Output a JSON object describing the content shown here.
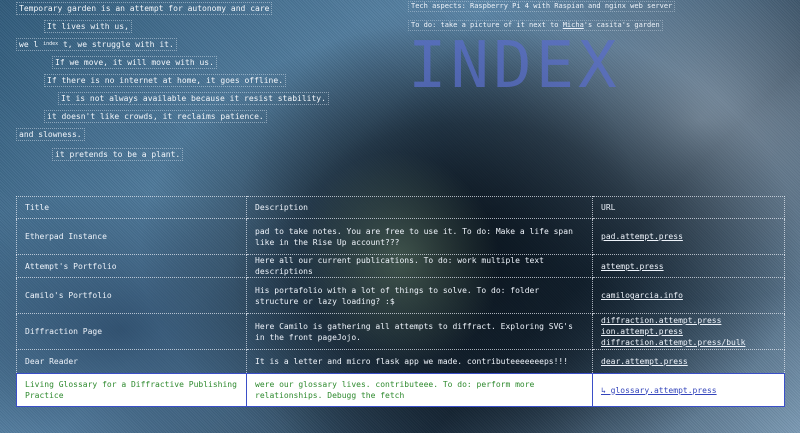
{
  "manifesto": {
    "lines": [
      "Temporary garden is an attempt for autonomy and care",
      "It lives with us,",
      "we l",
      "index",
      "t, we struggle with it.",
      "If we move, it will move with us.",
      "If there is no internet at home, it goes offline.",
      "It is not always available because it resist stability.",
      "it doesn't like crowds, it reclaims patience.",
      "and slowness.",
      "it pretends to be a plant."
    ]
  },
  "tech": {
    "line1": "Tech aspects: Raspberry Pi 4 with Raspian and nginx web server",
    "line2_prefix": "To do: take a picture of it next to ",
    "line2_link": "Micha",
    "line2_suffix": "'s casita's garden"
  },
  "overlay": {
    "index_word": "INDEX"
  },
  "table": {
    "headers": {
      "title": "Title",
      "description": "Description",
      "url": "URL"
    },
    "rows": [
      {
        "title": "Etherpad Instance",
        "description": "pad to take notes. You are free to use it. To do: Make a life span like in the Rise Up account???",
        "urls": [
          "pad.attempt.press"
        ]
      },
      {
        "title": "Attempt's Portfolio",
        "description": "Here all our current publications. To do: work multiple text descriptions",
        "urls": [
          "attempt.press"
        ]
      },
      {
        "title": "Camilo's Portfolio",
        "description": "His portafolio with a lot of things to solve. To do: folder structure or lazy loading? :$",
        "urls": [
          "camilogarcia.info"
        ]
      },
      {
        "title": "Diffraction Page",
        "description": "Here Camilo is gathering all attempts to diffract. Exploring SVG's in the front pageJojo.",
        "urls": [
          "diffraction.attempt.press",
          "ion.attempt.press",
          "diffraction.attempt.press/bulk"
        ]
      },
      {
        "title": "Dear Reader",
        "description": "It is a letter and micro flask app we made. contributeeeeeeeps!!!",
        "urls": [
          "dear.attempt.press"
        ]
      },
      {
        "title": "Living Glossary for a Diffractive Publishing Practice",
        "description": "were our glossary lives. contributeee. To do: perform more relationships. Debugg the fetch",
        "urls": [
          "↳ glossary.attempt.press"
        ]
      }
    ]
  }
}
